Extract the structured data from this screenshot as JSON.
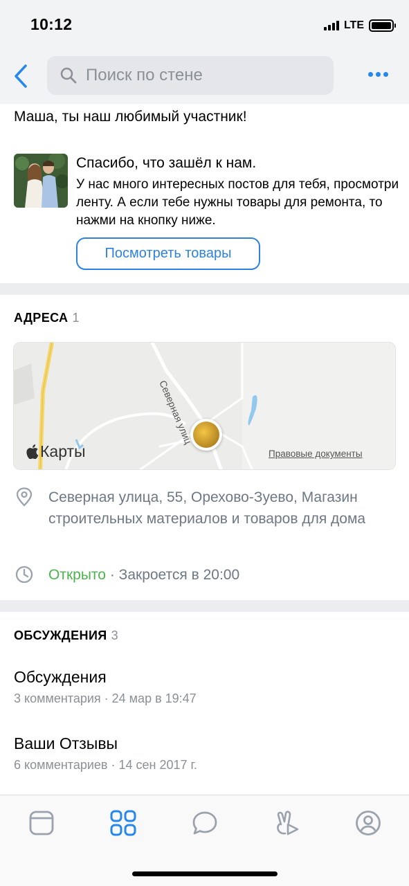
{
  "status_bar": {
    "time": "10:12",
    "network": "LTE"
  },
  "nav": {
    "search_placeholder": "Поиск по стене"
  },
  "greeting": "Маша, ты наш любимый участник!",
  "welcome": {
    "title": "Спасибо, что зашёл к нам.",
    "text": "У нас много интересных постов для тебя, просмотри ленту. А если тебе нужны товары для ремонта, то нажми на кнопку ниже.",
    "button_label": "Посмотреть товары"
  },
  "addresses": {
    "header": "АДРЕСА",
    "count": "1",
    "map": {
      "logo_text": "Карты",
      "legal_link": "Правовые документы",
      "street_label": "Северная улиц"
    },
    "address_text": "Северная улица, 55, Орехово-Зуево, Магазин строительных материалов и товаров для дома",
    "open_status": "Открыто",
    "hours": " · Закроется в 20:00"
  },
  "discussions": {
    "header": "ОБСУЖДЕНИЯ",
    "count": "3",
    "items": [
      {
        "title": "Обсуждения",
        "meta": "3 комментария · 24 мар в 19:47"
      },
      {
        "title": "Ваши Отзывы",
        "meta": "6 комментариев · 14 сен 2017 г."
      }
    ]
  },
  "tabs": [
    {
      "icon": "feed-icon",
      "active": false
    },
    {
      "icon": "services-icon",
      "active": true
    },
    {
      "icon": "messages-icon",
      "active": false
    },
    {
      "icon": "clips-icon",
      "active": false
    },
    {
      "icon": "profile-icon",
      "active": false
    }
  ],
  "colors": {
    "accent": "#2688eb",
    "open": "#4bb34b",
    "secondary": "#8b8f96"
  }
}
